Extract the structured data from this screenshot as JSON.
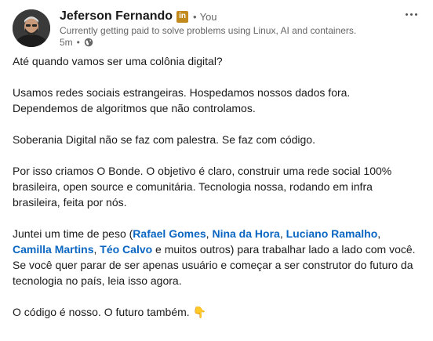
{
  "author": {
    "name": "Jeferson Fernando",
    "badge": "in",
    "separator": "•",
    "relation": "You",
    "headline": "Currently getting paid to solve problems using Linux, AI and containers.",
    "time": "5m",
    "time_separator": "•",
    "visibility_icon": "globe-icon"
  },
  "menu": {
    "icon": "more-horizontal-icon"
  },
  "post": {
    "p1": "Até quando vamos ser uma colônia digital?",
    "p2_l1": "Usamos redes sociais estrangeiras. Hospedamos nossos dados fora.",
    "p2_l2": "Dependemos de algoritmos que não controlamos.",
    "p3": "Soberania Digital não se faz com palestra. Se faz com código.",
    "p4": "Por isso criamos O Bonde. O objetivo é claro, construir uma rede social 100% brasileira, open source e comunitária. Tecnologia nossa, rodando em infra brasileira, feita por nós.",
    "p5_prefix": "Juntei um time de peso (",
    "mentions": [
      "Rafael Gomes",
      "Nina da Hora",
      "Luciano Ramalho",
      "Camilla Martins",
      "Téo Calvo"
    ],
    "comma": ",",
    "p5_suffix": " e muitos outros) para trabalhar lado a lado com você.",
    "p6": "Se você quer parar de ser apenas usuário e começar a ser construtor do futuro da tecnologia no país, leia isso agora.",
    "p7": "O código é nosso. O futuro também.",
    "p7_emoji": "👇"
  }
}
